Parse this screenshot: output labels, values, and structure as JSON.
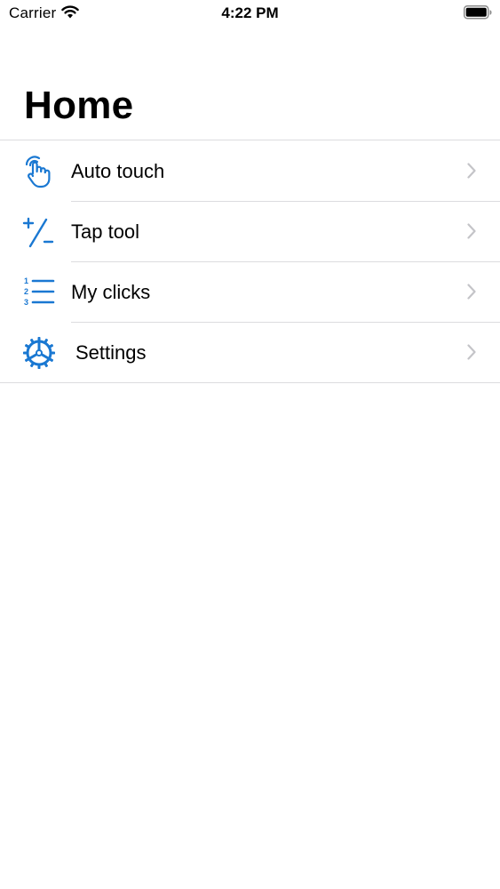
{
  "status_bar": {
    "carrier": "Carrier",
    "time": "4:22 PM"
  },
  "header": {
    "title": "Home"
  },
  "colors": {
    "accent": "#1a78d2",
    "separator": "#dcdcdf",
    "chevron": "#c4c4c8"
  },
  "menu": {
    "items": [
      {
        "label": "Auto touch",
        "icon": "hand-touch-icon"
      },
      {
        "label": "Tap tool",
        "icon": "plus-minus-icon"
      },
      {
        "label": "My clicks",
        "icon": "numbered-list-icon"
      },
      {
        "label": "Settings",
        "icon": "gear-icon"
      }
    ]
  }
}
